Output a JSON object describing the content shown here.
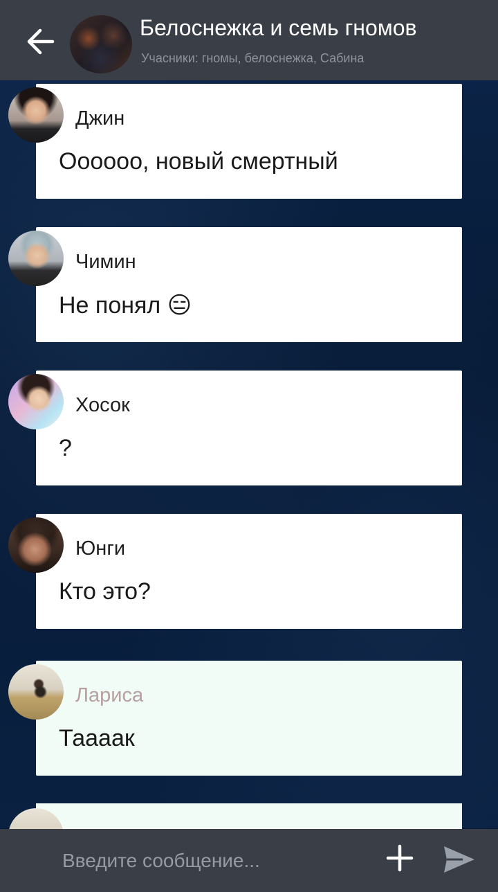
{
  "header": {
    "title": "Белоснежка и семь гномов",
    "subtitle": "Учасники: гномы, белоснежка, Сабина",
    "back_icon": "arrow-left-icon",
    "avatar": "group-avatar"
  },
  "messages": [
    {
      "sender": "Джин",
      "text": "Оооооо, новый смертный",
      "avatar": "avatar-jin",
      "highlight": false
    },
    {
      "sender": "Чимин",
      "text": "Не понял 😑",
      "avatar": "avatar-jimin",
      "highlight": false
    },
    {
      "sender": "Хосок",
      "text": "?",
      "avatar": "avatar-hosok",
      "highlight": false
    },
    {
      "sender": "Юнги",
      "text": "Кто это?",
      "avatar": "avatar-yungi",
      "highlight": false
    },
    {
      "sender": "Лариса",
      "text": "Таааак",
      "avatar": "avatar-larisa",
      "highlight": true
    }
  ],
  "composer": {
    "placeholder": "Введите сообщение...",
    "plus_icon": "plus-icon",
    "send_icon": "send-icon"
  },
  "colors": {
    "header_bg": "#3a3e47",
    "chat_bg": "#061a35",
    "bubble_bg": "#ffffff",
    "highlight_bubble_bg": "#f2fcf6",
    "highlight_sender": "#b6a1a1"
  }
}
